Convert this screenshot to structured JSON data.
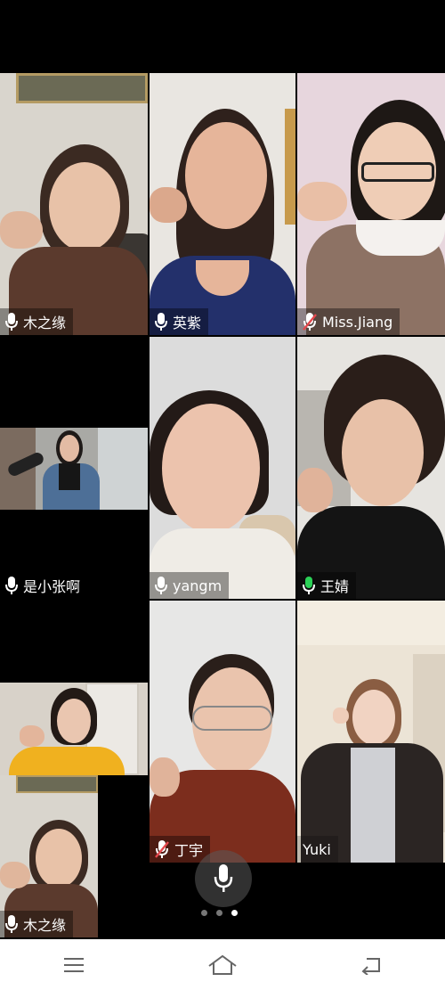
{
  "tiles": [
    {
      "name": "木之缘",
      "mic": "on"
    },
    {
      "name": "英紫",
      "mic": "on"
    },
    {
      "name": "Miss.Jiang",
      "mic": "muted"
    },
    {
      "name": "是小张啊",
      "mic": "on"
    },
    {
      "name": "yangm",
      "mic": "on"
    },
    {
      "name": "王婧",
      "mic": "active"
    },
    {
      "name": "丁宇",
      "mic": "muted"
    },
    {
      "name": "Yuki",
      "mic": "none"
    }
  ],
  "pip": {
    "name": "木之缘",
    "mic": "on"
  },
  "pager": {
    "pages": 3,
    "current": 3
  },
  "nav": {
    "items": [
      "menu-icon",
      "home-icon",
      "back-icon"
    ]
  },
  "colors": {
    "mic_active": "#2bd157",
    "mic_muted": "#e5484d",
    "background": "#000000"
  }
}
